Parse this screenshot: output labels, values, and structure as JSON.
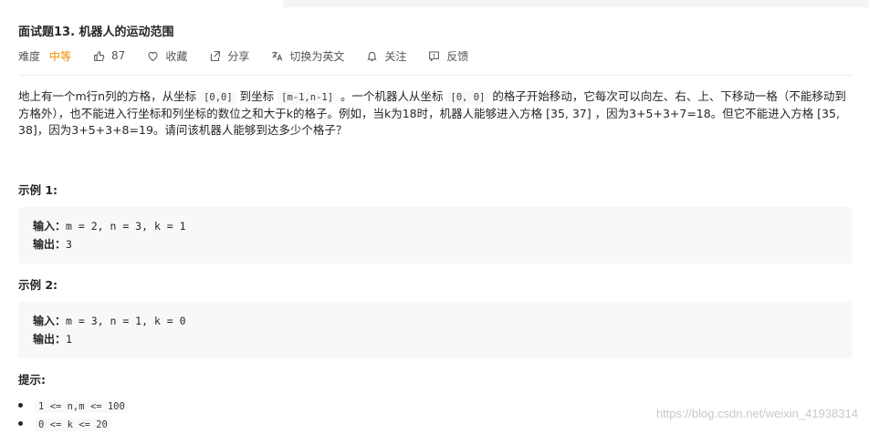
{
  "title": "面试题13. 机器人的运动范围",
  "meta": {
    "difficulty_label": "难度",
    "difficulty_value": "中等",
    "likes": "87",
    "favorite": "收藏",
    "share": "分享",
    "switch_lang": "切换为英文",
    "follow": "关注",
    "feedback": "反馈"
  },
  "description": {
    "p1": "地上有一个m行n列的方格，从坐标 ",
    "c1": "[0,0]",
    "p2": " 到坐标 ",
    "c2": "[m-1,n-1]",
    "p3": " 。一个机器人从坐标 ",
    "c3": "[0, 0]",
    "p4": " 的格子开始移动，它每次可以向左、右、上、下移动一格（不能移动到方格外），也不能进入行坐标和列坐标的数位之和大于k的格子。例如，当k为18时，机器人能够进入方格 [35, 37] ，因为3+5+3+7=18。但它不能进入方格 [35, 38]，因为3+5+3+8=19。请问该机器人能够到达多少个格子？"
  },
  "examples": [
    {
      "title": "示例 1:",
      "input_label": "输入：",
      "input": "m = 2, n = 3, k = 1",
      "output_label": "输出：",
      "output": "3"
    },
    {
      "title": "示例 2:",
      "input_label": "输入：",
      "input": "m = 3, n = 1, k = 0",
      "output_label": "输出：",
      "output": "1"
    }
  ],
  "hints": {
    "title": "提示:",
    "items": [
      "1 <= n,m <= 100",
      "0 <= k  <= 20"
    ]
  },
  "watermark": "https://blog.csdn.net/weixin_41938314"
}
